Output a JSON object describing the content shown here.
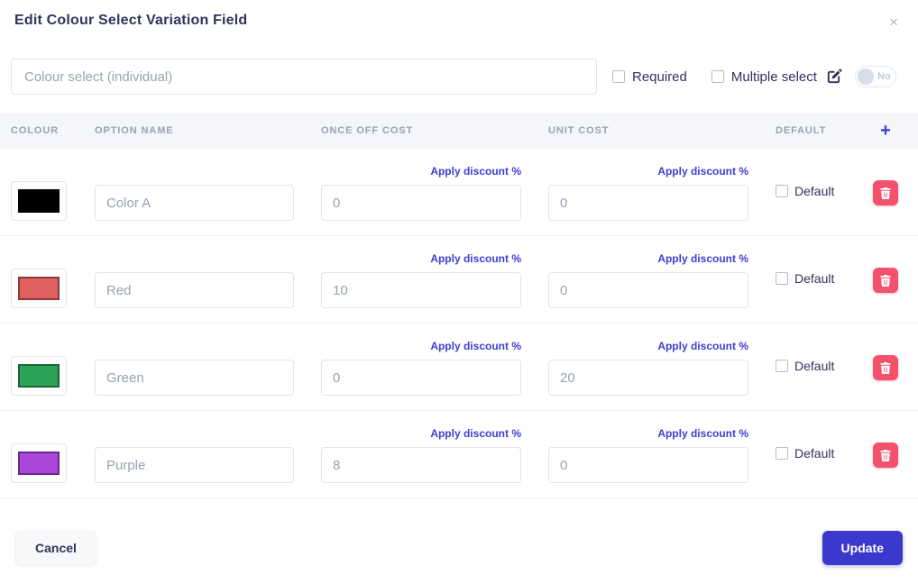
{
  "modal": {
    "title": "Edit Colour Select Variation Field",
    "close_icon": "×"
  },
  "controls": {
    "field_name_placeholder": "Colour select (individual)",
    "required_label": "Required",
    "multiple_select_label": "Multiple select",
    "toggle_state_label": "No"
  },
  "table": {
    "headers": [
      "Colour",
      "Option name",
      "Once off cost",
      "Unit cost",
      "Default"
    ],
    "add_icon": "+",
    "apply_discount_label": "Apply discount",
    "percent_icon": "%",
    "default_checkbox_label": "Default",
    "rows": [
      {
        "color_name": "black",
        "color_hex": "#000000",
        "option_name": "Color A",
        "once_off_cost": "0",
        "unit_cost": "0"
      },
      {
        "color_name": "red",
        "color_hex": "#e05f5f",
        "option_name": "Red",
        "once_off_cost": "10",
        "unit_cost": "0"
      },
      {
        "color_name": "green",
        "color_hex": "#29a356",
        "option_name": "Green",
        "once_off_cost": "0",
        "unit_cost": "20"
      },
      {
        "color_name": "purple",
        "color_hex": "#aa46da",
        "option_name": "Purple",
        "once_off_cost": "8",
        "unit_cost": "0"
      }
    ]
  },
  "footer": {
    "cancel_label": "Cancel",
    "update_label": "Update"
  },
  "colors": {
    "accent_indigo": "#3e3ed2",
    "update_button": "#3b38cd",
    "danger_red": "#f4516c",
    "title_navy": "#32325d",
    "header_bg": "#f4f6f9"
  }
}
